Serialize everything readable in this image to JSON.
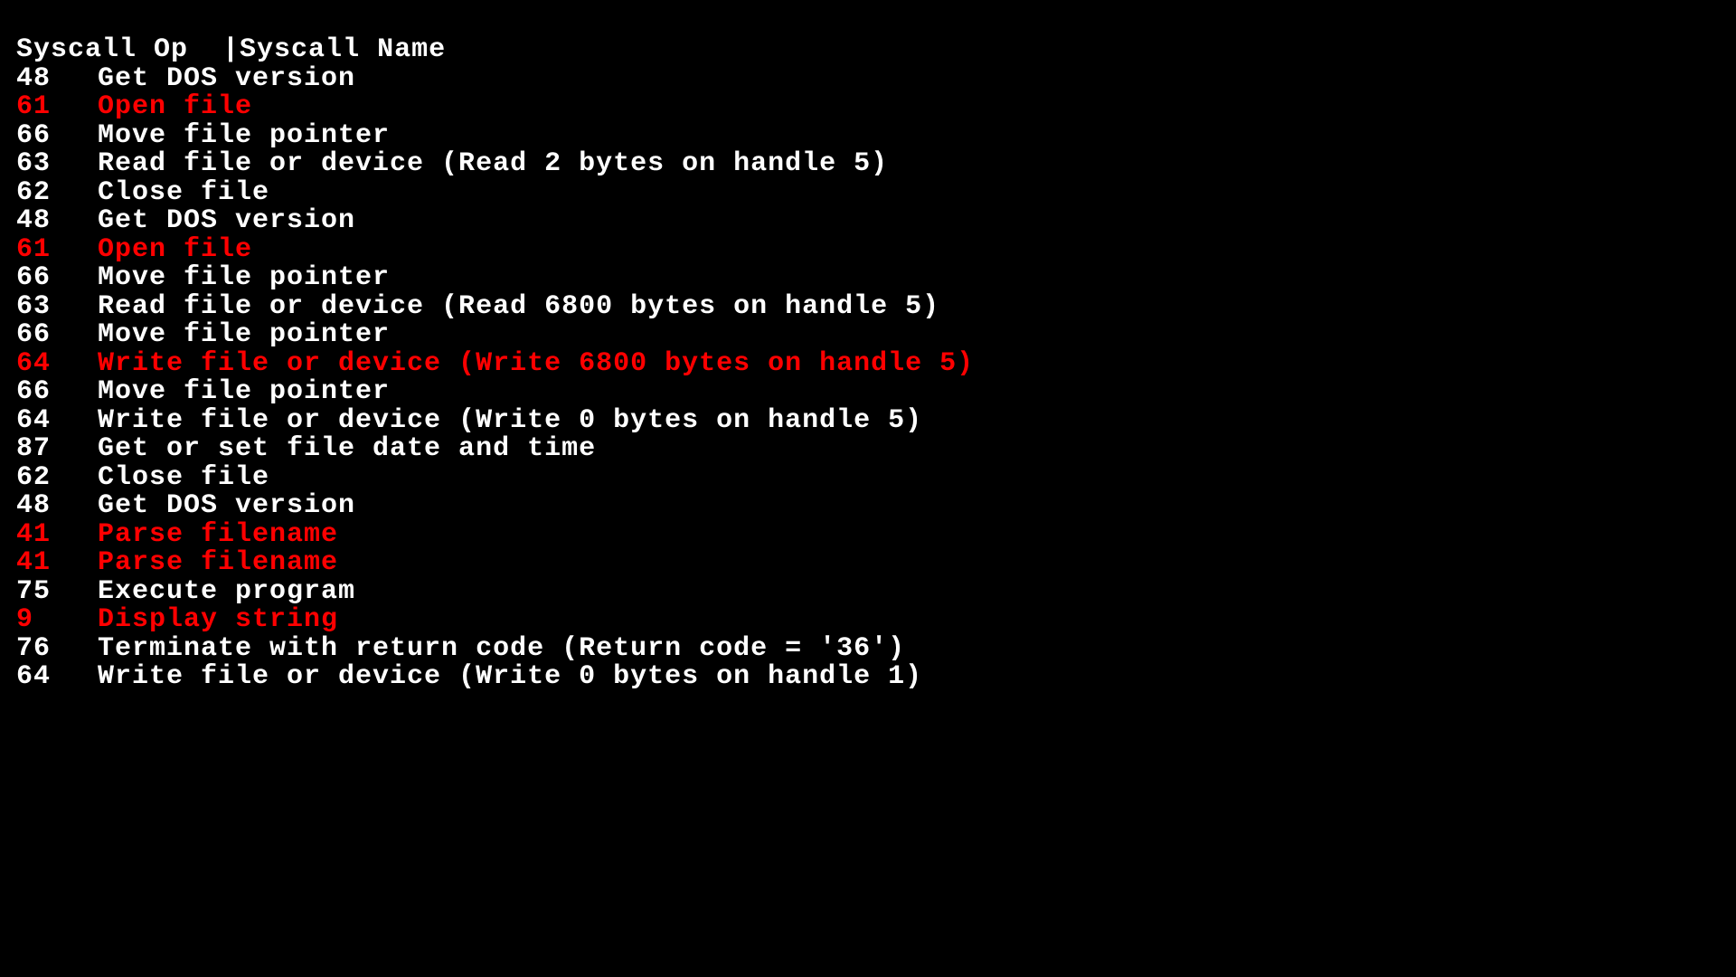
{
  "header": {
    "col1": "Syscall Op",
    "col2": "Syscall Name"
  },
  "rows": [
    {
      "op": "48",
      "name": "Get DOS version",
      "highlight": false
    },
    {
      "op": "61",
      "name": "Open file",
      "highlight": true
    },
    {
      "op": "66",
      "name": "Move file pointer",
      "highlight": false
    },
    {
      "op": "63",
      "name": "Read file or device (Read 2 bytes on handle 5)",
      "highlight": false
    },
    {
      "op": "62",
      "name": "Close file",
      "highlight": false
    },
    {
      "op": "48",
      "name": "Get DOS version",
      "highlight": false
    },
    {
      "op": "61",
      "name": "Open file",
      "highlight": true
    },
    {
      "op": "66",
      "name": "Move file pointer",
      "highlight": false
    },
    {
      "op": "63",
      "name": "Read file or device (Read 6800 bytes on handle 5)",
      "highlight": false
    },
    {
      "op": "66",
      "name": "Move file pointer",
      "highlight": false
    },
    {
      "op": "64",
      "name": "Write file or device (Write 6800 bytes on handle 5)",
      "highlight": true
    },
    {
      "op": "66",
      "name": "Move file pointer",
      "highlight": false
    },
    {
      "op": "64",
      "name": "Write file or device (Write 0 bytes on handle 5)",
      "highlight": false
    },
    {
      "op": "87",
      "name": "Get or set file date and time",
      "highlight": false
    },
    {
      "op": "62",
      "name": "Close file",
      "highlight": false
    },
    {
      "op": "48",
      "name": "Get DOS version",
      "highlight": false
    },
    {
      "op": "41",
      "name": "Parse filename",
      "highlight": true
    },
    {
      "op": "41",
      "name": "Parse filename",
      "highlight": true
    },
    {
      "op": "75",
      "name": "Execute program",
      "highlight": false
    },
    {
      "op": "9",
      "name": "Display string",
      "highlight": true
    },
    {
      "op": "76",
      "name": "Terminate with return code (Return code = '36')",
      "highlight": false
    },
    {
      "op": "64",
      "name": "Write file or device (Write 0 bytes on handle 1)",
      "highlight": false
    }
  ]
}
